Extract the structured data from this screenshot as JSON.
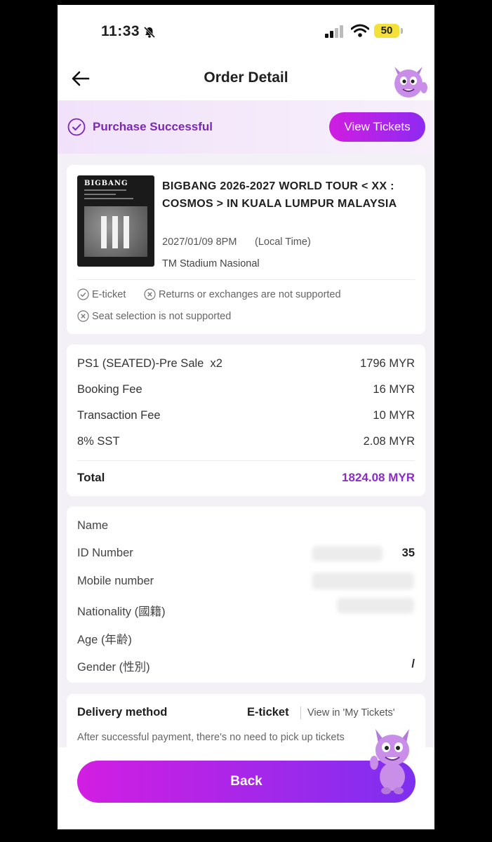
{
  "status_bar": {
    "time": "11:33",
    "battery": "50"
  },
  "header": {
    "title": "Order Detail"
  },
  "banner": {
    "status": "Purchase Successful",
    "view_tickets": "View Tickets"
  },
  "event": {
    "poster_title": "BIGBANG",
    "title": "BIGBANG 2026-2027 WORLD TOUR < XX : COSMOS > IN KUALA LUMPUR MALAYSIA",
    "date": "2027/01/09 8PM",
    "local_time": "(Local Time)",
    "venue": "TM Stadium Nasional",
    "tags": [
      "E-ticket",
      "Returns or exchanges are not supported",
      "Seat selection is not supported"
    ]
  },
  "price": {
    "rows": [
      {
        "label": "PS1 (SEATED)-Pre Sale  x2",
        "amount": "1796 MYR"
      },
      {
        "label": "Booking Fee",
        "amount": "16 MYR"
      },
      {
        "label": "Transaction Fee",
        "amount": "10 MYR"
      },
      {
        "label": "8% SST",
        "amount": "2.08 MYR"
      }
    ],
    "total_label": "Total",
    "total_amount": "1824.08 MYR"
  },
  "info": {
    "labels": [
      "Name",
      "ID Number",
      "Mobile number",
      "Nationality (國籍)",
      "Age (年齢)",
      "Gender (性別)"
    ],
    "id_suffix": "35",
    "gender_value": "/"
  },
  "delivery": {
    "label": "Delivery method",
    "value": "E-ticket",
    "link": "View in 'My Tickets'",
    "note": "After successful payment, there's no need to pick up tickets"
  },
  "footer": {
    "back": "Back"
  },
  "colors": {
    "accent": "#8a2cc8",
    "gradient_start": "#d01de0",
    "gradient_end": "#8e2af2"
  }
}
